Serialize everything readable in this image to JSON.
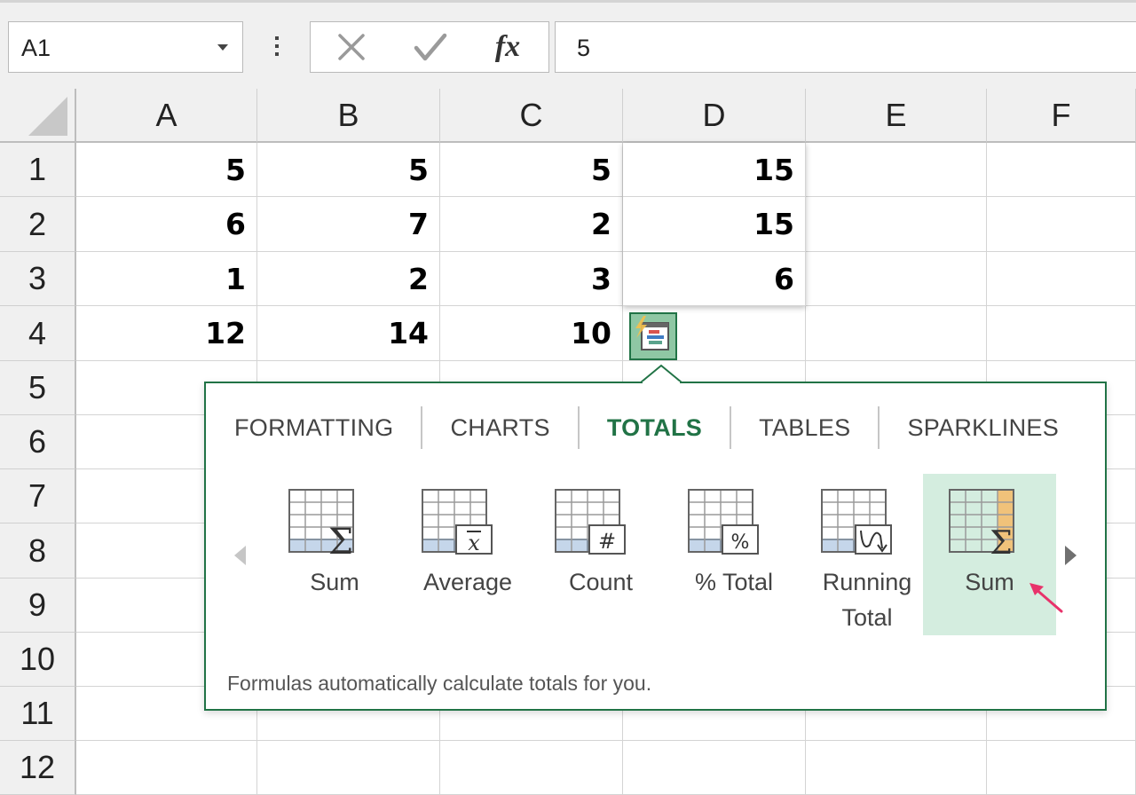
{
  "formula_bar": {
    "name_box": "A1",
    "cancel_icon": "x-icon",
    "enter_icon": "check-icon",
    "function_label": "fx",
    "formula_value": "5"
  },
  "grid": {
    "columns": [
      "A",
      "B",
      "C",
      "D",
      "E",
      "F"
    ],
    "rows": [
      "1",
      "2",
      "3",
      "4",
      "5",
      "6",
      "7",
      "8",
      "9",
      "10",
      "11",
      "12"
    ],
    "cells": [
      [
        "5",
        "5",
        "5",
        "15",
        "",
        ""
      ],
      [
        "6",
        "7",
        "2",
        "15",
        "",
        ""
      ],
      [
        "1",
        "2",
        "3",
        "6",
        "",
        ""
      ],
      [
        "12",
        "14",
        "10",
        "",
        "",
        ""
      ]
    ]
  },
  "quick_analysis": {
    "button_icon": "quick-analysis-icon",
    "tabs": [
      {
        "label": "FORMATTING",
        "active": false
      },
      {
        "label": "CHARTS",
        "active": false
      },
      {
        "label": "TOTALS",
        "active": true
      },
      {
        "label": "TABLES",
        "active": false
      },
      {
        "label": "SPARKLINES",
        "active": false
      }
    ],
    "items": [
      {
        "label": "Sum",
        "icon": "sum-row-icon",
        "active": false
      },
      {
        "label": "Average",
        "icon": "average-icon",
        "active": false
      },
      {
        "label": "Count",
        "icon": "count-icon",
        "active": false
      },
      {
        "label": "% Total",
        "icon": "percent-total-icon",
        "active": false
      },
      {
        "label": "Running Total",
        "icon": "running-total-icon",
        "active": false
      },
      {
        "label": "Sum",
        "icon": "sum-column-icon",
        "active": true
      }
    ],
    "description": "Formulas automatically calculate totals for you.",
    "colors": {
      "accent": "#217346",
      "active_item_bg": "#d4eddf",
      "row_highlight": "#4a7ebb",
      "column_highlight": "#f0c27a",
      "cursor": "#e8336b"
    }
  }
}
